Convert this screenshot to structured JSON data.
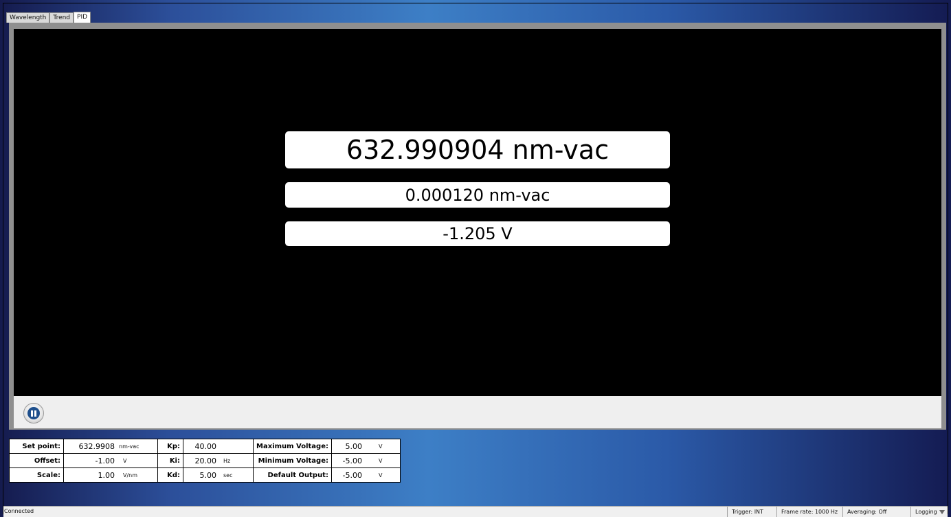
{
  "tabs": [
    {
      "label": "Wavelength",
      "active": false
    },
    {
      "label": "Trend",
      "active": false
    },
    {
      "label": "PID",
      "active": true
    }
  ],
  "readouts": {
    "wavelength": "632.990904 nm-vac",
    "deviation": "0.000120 nm-vac",
    "voltage": "-1.205 V"
  },
  "controls": {
    "pause_icon": "pause-icon"
  },
  "params": {
    "set_point": {
      "label": "Set point:",
      "value": "632.9908",
      "unit": "nm-vac"
    },
    "offset": {
      "label": "Offset:",
      "value": "-1.00",
      "unit": "V"
    },
    "scale": {
      "label": "Scale:",
      "value": "1.00",
      "unit": "V/nm"
    },
    "kp": {
      "label": "Kp:",
      "value": "40.00",
      "unit": ""
    },
    "ki": {
      "label": "Ki:",
      "value": "20.00",
      "unit": "Hz"
    },
    "kd": {
      "label": "Kd:",
      "value": "5.00",
      "unit": "sec"
    },
    "max_voltage": {
      "label": "Maximum Voltage:",
      "value": "5.00",
      "unit": "V"
    },
    "min_voltage": {
      "label": "Minimum Voltage:",
      "value": "-5.00",
      "unit": "V"
    },
    "default_output": {
      "label": "Default Output:",
      "value": "-5.00",
      "unit": "V"
    }
  },
  "status": {
    "connection": "Connected",
    "trigger": "Trigger: INT",
    "frame_rate": "Frame rate: 1000 Hz",
    "averaging": "Averaging: Off",
    "logging": "Logging"
  }
}
